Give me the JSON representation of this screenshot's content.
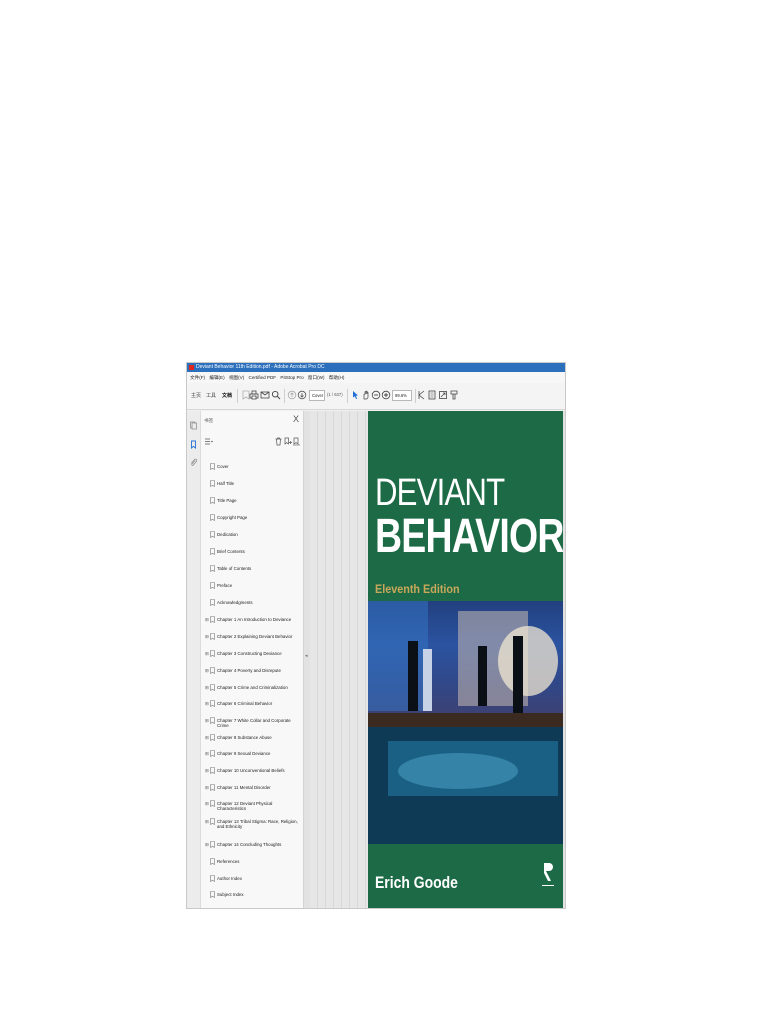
{
  "window": {
    "title": "Deviant Behavior 11th Edition.pdf - Adobe Acrobat Pro DC"
  },
  "menu": {
    "items": [
      "文件(F)",
      "编辑(E)",
      "视图(V)",
      "Certified PDF",
      "PitStop Pro",
      "窗口(W)",
      "帮助(H)"
    ]
  },
  "toolbar": {
    "tabs": [
      "主页",
      "工具",
      "文档"
    ],
    "page_field": "Cover",
    "page_count": "(1 / 637)",
    "zoom": "99.6%"
  },
  "panel": {
    "title": "书签",
    "close": "X",
    "bookmarks": [
      {
        "label": "Cover",
        "expandable": false
      },
      {
        "label": "Half Title",
        "expandable": false
      },
      {
        "label": "Title Page",
        "expandable": false
      },
      {
        "label": "Copyright Page",
        "expandable": false
      },
      {
        "label": "Dedication",
        "expandable": false
      },
      {
        "label": "Brief Contents",
        "expandable": false
      },
      {
        "label": "Table of Contents",
        "expandable": false
      },
      {
        "label": "Preface",
        "expandable": false
      },
      {
        "label": "Acknowledgments",
        "expandable": false
      },
      {
        "label": "Chapter 1 An Introduction to Deviance",
        "expandable": true
      },
      {
        "label": "Chapter 2 Explaining Deviant Behavior",
        "expandable": true
      },
      {
        "label": "Chapter 3 Constructing Deviance",
        "expandable": true
      },
      {
        "label": "Chapter 4 Poverty and Disrepute",
        "expandable": true
      },
      {
        "label": "Chapter 5 Crime and Criminalization",
        "expandable": true
      },
      {
        "label": "Chapter 6 Criminal Behavior",
        "expandable": true
      },
      {
        "label": "Chapter 7 White Collar and Corporate Crime",
        "expandable": true
      },
      {
        "label": "Chapter 8 Substance Abuse",
        "expandable": true
      },
      {
        "label": "Chapter 9 Sexual Deviance",
        "expandable": true
      },
      {
        "label": "Chapter 10 Unconventional Beliefs",
        "expandable": true
      },
      {
        "label": "Chapter 11 Mental Disorder",
        "expandable": true
      },
      {
        "label": "Chapter 12 Deviant Physical Characteristics",
        "expandable": true
      },
      {
        "label": "Chapter 13 Tribal Stigma: Race, Religion, and Ethnicity",
        "expandable": true
      },
      {
        "label": "Chapter 14 Concluding Thoughts",
        "expandable": true
      },
      {
        "label": "References",
        "expandable": false
      },
      {
        "label": "Author Index",
        "expandable": false
      },
      {
        "label": "Subject Index",
        "expandable": false
      }
    ]
  },
  "cover": {
    "title_line1": "DEVIANT",
    "title_line2": "BEHAVIOR",
    "edition": "Eleventh Edition",
    "author": "Erich Goode"
  },
  "colors": {
    "cover_green": "#1d6b46",
    "edition_gold": "#c8a75a",
    "titlebar_blue": "#2b6fbd"
  }
}
